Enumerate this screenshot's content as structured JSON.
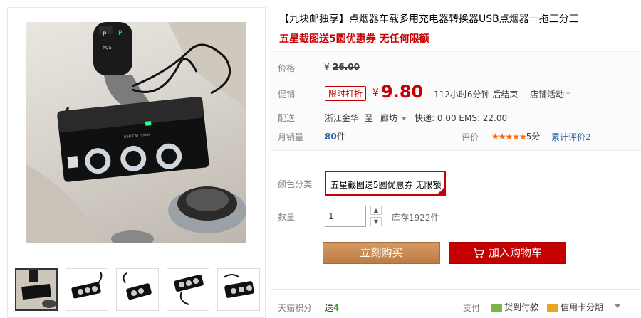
{
  "product": {
    "title": "【九块邮独享】点烟器车载多用充电器转换器USB点烟器一拖三分三",
    "subtitle": "五星截图送5圆优惠券 无任何限额"
  },
  "price": {
    "label": "价格",
    "currency": "¥",
    "original": "26.00"
  },
  "promo": {
    "label": "促销",
    "tag": "限时打折",
    "currency": "¥",
    "price": "9.80",
    "countdown": "112小时6分钟 后结束",
    "store_activity": "店铺活动"
  },
  "delivery": {
    "label": "配送",
    "from": "浙江金华",
    "to_word": "至",
    "destination": "廊坊",
    "shipping": "快递: 0.00 EMS: 22.00"
  },
  "sales": {
    "label": "月销量",
    "count": "80",
    "unit": "件",
    "rating_label": "评价",
    "stars": "★★★★★",
    "score": "5分",
    "review_link": "累计评价2"
  },
  "sku": {
    "label": "颜色分类",
    "selected": "五星截图送5圆优惠券 无限额"
  },
  "quantity": {
    "label": "数量",
    "value": "1",
    "stock": "库存1922件",
    "up": "▲",
    "down": "▼"
  },
  "actions": {
    "buy_now": "立刻购买",
    "add_to_cart": "加入购物车"
  },
  "footer": {
    "points_label": "天猫积分",
    "points_text": "送",
    "points_value": "4",
    "pay_label": "支付",
    "cod": "货到付款",
    "installment": "信用卡分期"
  },
  "colors": {
    "accent_red": "#c40000",
    "buy_orange": "#c0804b",
    "star_orange": "#ff6600",
    "link_blue": "#3366aa"
  }
}
